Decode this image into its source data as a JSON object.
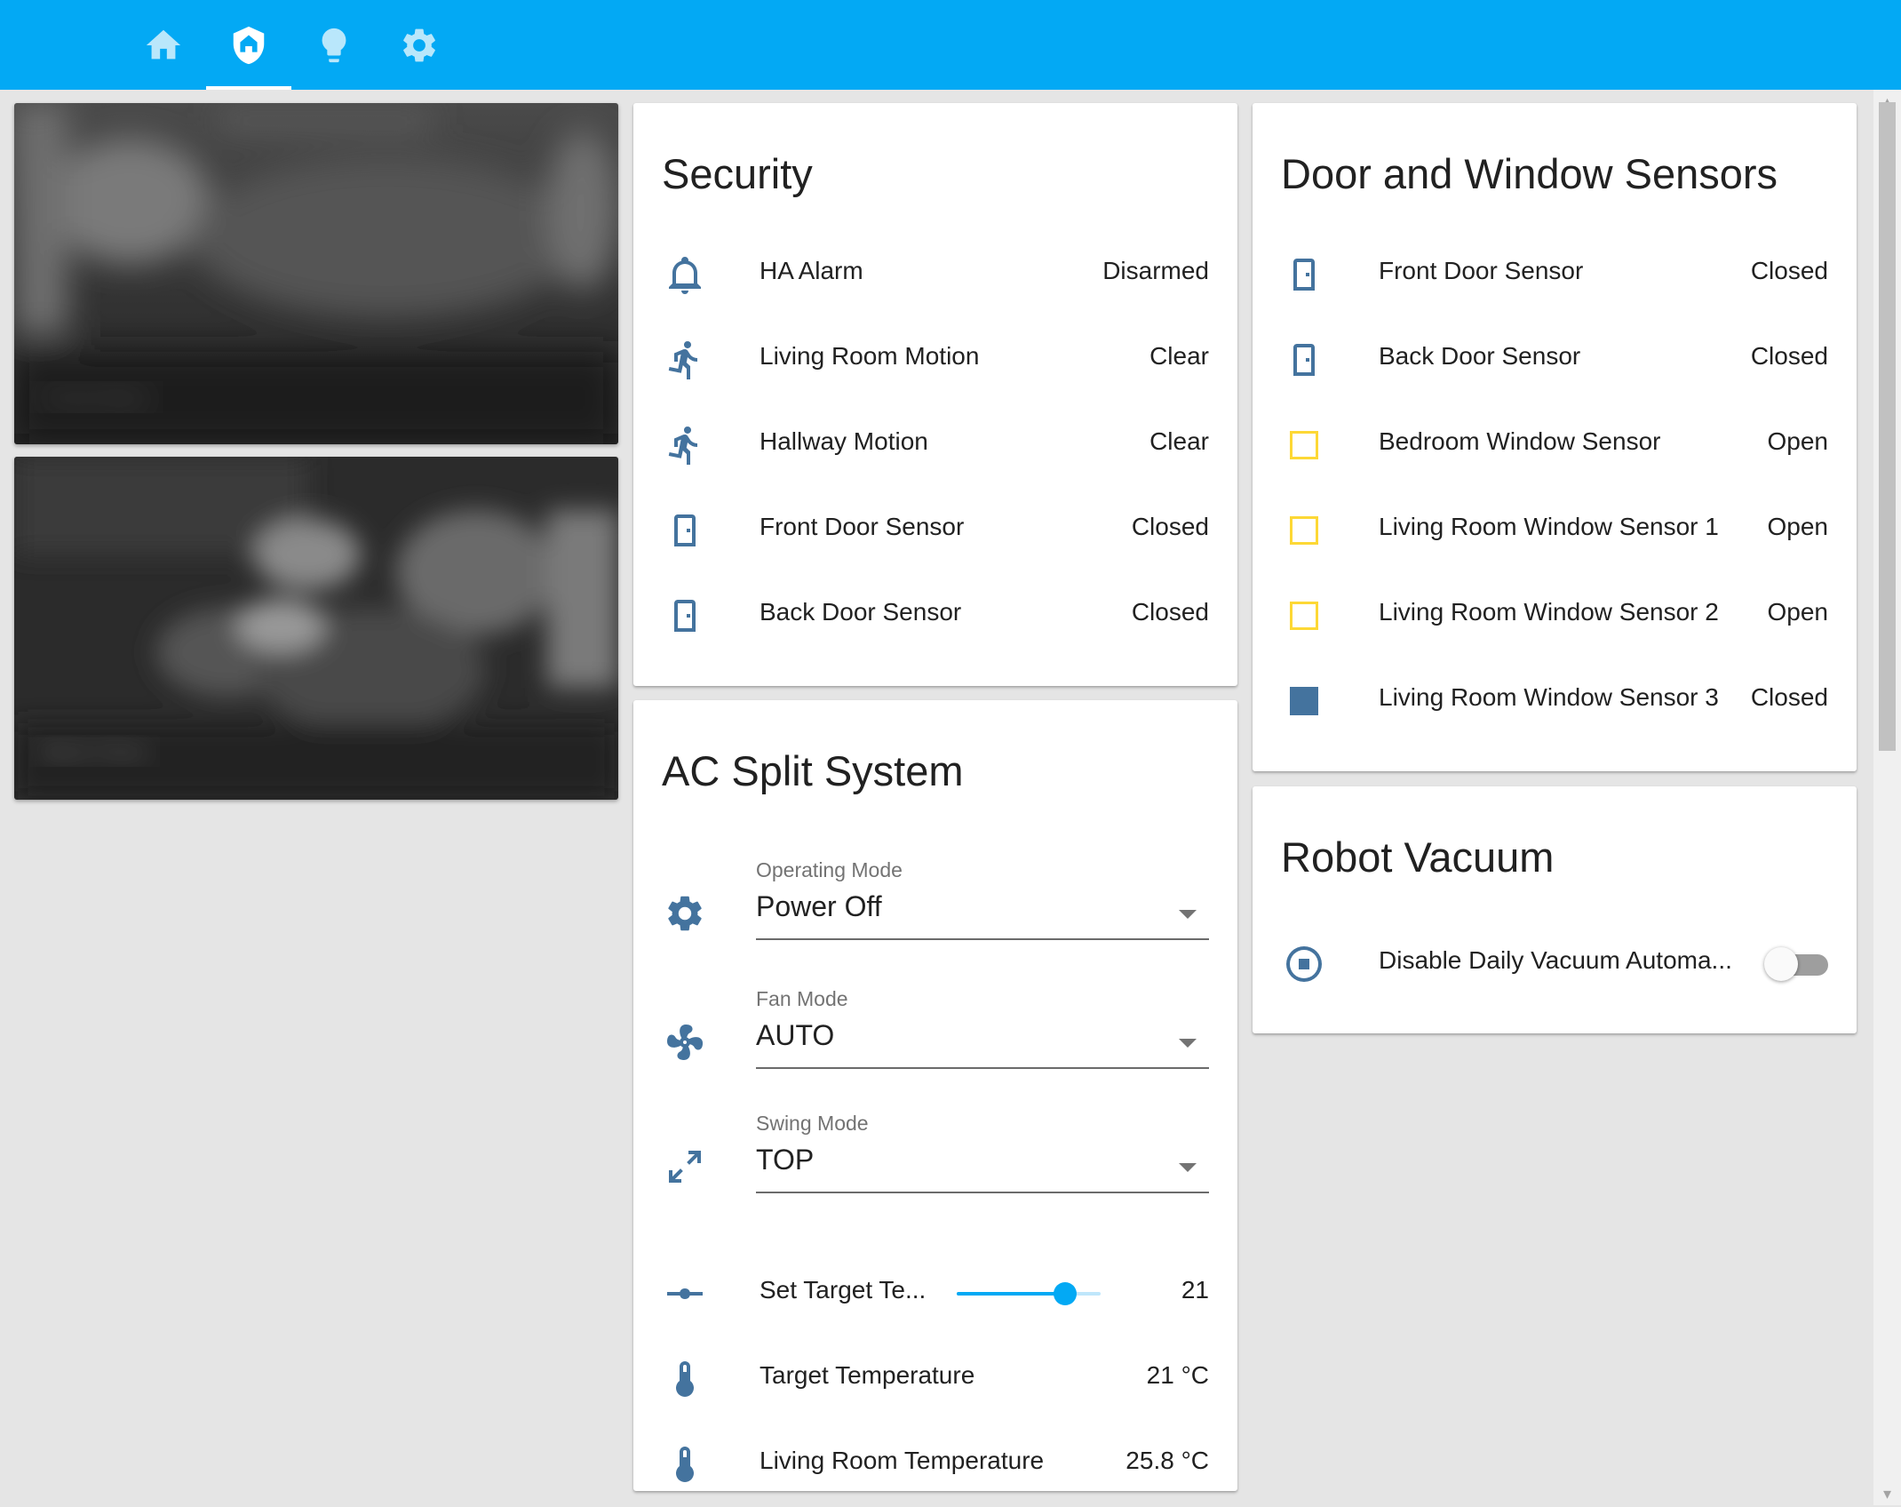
{
  "tabs": [
    {
      "icon": "home-icon",
      "active": false
    },
    {
      "icon": "shield-home-icon",
      "active": true
    },
    {
      "icon": "lightbulb-icon",
      "active": false
    },
    {
      "icon": "gear-icon",
      "active": false
    }
  ],
  "cameras": [
    {
      "label": "Front Door"
    },
    {
      "label": "Back Door"
    }
  ],
  "security": {
    "title": "Security",
    "rows": [
      {
        "icon": "bell-icon",
        "name": "HA Alarm",
        "state": "Disarmed"
      },
      {
        "icon": "walk-icon",
        "name": "Living Room Motion",
        "state": "Clear"
      },
      {
        "icon": "walk-icon",
        "name": "Hallway Motion",
        "state": "Clear"
      },
      {
        "icon": "door-icon",
        "name": "Front Door Sensor",
        "state": "Closed"
      },
      {
        "icon": "door-icon",
        "name": "Back Door Sensor",
        "state": "Closed"
      }
    ]
  },
  "ac": {
    "title": "AC Split System",
    "operating_mode": {
      "label": "Operating Mode",
      "value": "Power Off",
      "icon": "gear-icon"
    },
    "fan_mode": {
      "label": "Fan Mode",
      "value": "AUTO",
      "icon": "fan-icon"
    },
    "swing_mode": {
      "label": "Swing Mode",
      "value": "TOP",
      "icon": "arrow-expand-icon"
    },
    "set_target": {
      "name": "Set Target Te...",
      "value": "21",
      "slider_fraction": 0.75,
      "icon": "ray-vertex-icon"
    },
    "target_temp": {
      "name": "Target Temperature",
      "state": "21 °C",
      "icon": "thermometer-icon"
    },
    "living_temp": {
      "name": "Living Room Temperature",
      "state": "25.8 °C",
      "icon": "thermometer-icon"
    }
  },
  "doors": {
    "title": "Door and Window Sensors",
    "rows": [
      {
        "icon": "door-icon",
        "name": "Front Door Sensor",
        "state": "Closed"
      },
      {
        "icon": "door-icon",
        "name": "Back Door Sensor",
        "state": "Closed"
      },
      {
        "icon": "square-outline-icon",
        "name": "Bedroom Window Sensor",
        "state": "Open"
      },
      {
        "icon": "square-outline-icon",
        "name": "Living Room Window Sensor 1",
        "state": "Open"
      },
      {
        "icon": "square-outline-icon",
        "name": "Living Room Window Sensor 2",
        "state": "Open"
      },
      {
        "icon": "square-icon",
        "name": "Living Room Window Sensor 3",
        "state": "Closed"
      }
    ]
  },
  "vacuum": {
    "title": "Robot Vacuum",
    "name": "Disable Daily Vacuum Automa...",
    "icon": "stop-circle-icon",
    "toggle_on": false
  },
  "colors": {
    "header": "#03a9f4",
    "icon": "#44739e",
    "open_sensor": "#fdd835",
    "background": "#e5e5e5"
  }
}
